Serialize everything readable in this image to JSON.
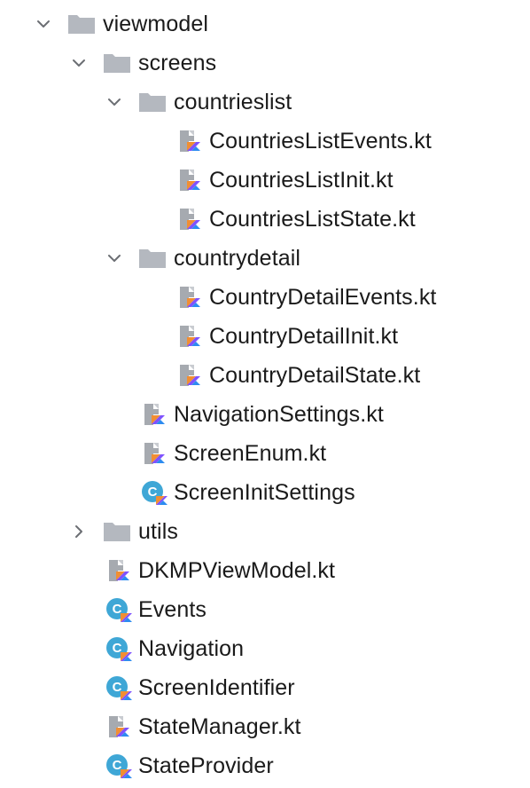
{
  "tree": {
    "rows": [
      {
        "name": "viewmodel",
        "type": "folder",
        "depth": 0,
        "expanded": true
      },
      {
        "name": "screens",
        "type": "folder",
        "depth": 1,
        "expanded": true
      },
      {
        "name": "countrieslist",
        "type": "folder",
        "depth": 2,
        "expanded": true
      },
      {
        "name": "CountriesListEvents.kt",
        "type": "kotlin-file",
        "depth": 3
      },
      {
        "name": "CountriesListInit.kt",
        "type": "kotlin-file",
        "depth": 3
      },
      {
        "name": "CountriesListState.kt",
        "type": "kotlin-file",
        "depth": 3
      },
      {
        "name": "countrydetail",
        "type": "folder",
        "depth": 2,
        "expanded": true
      },
      {
        "name": "CountryDetailEvents.kt",
        "type": "kotlin-file",
        "depth": 3
      },
      {
        "name": "CountryDetailInit.kt",
        "type": "kotlin-file",
        "depth": 3
      },
      {
        "name": "CountryDetailState.kt",
        "type": "kotlin-file",
        "depth": 3
      },
      {
        "name": "NavigationSettings.kt",
        "type": "kotlin-file",
        "depth": 2
      },
      {
        "name": "ScreenEnum.kt",
        "type": "kotlin-file",
        "depth": 2
      },
      {
        "name": "ScreenInitSettings",
        "type": "kotlin-class",
        "depth": 2
      },
      {
        "name": "utils",
        "type": "folder",
        "depth": 1,
        "expanded": false
      },
      {
        "name": "DKMPViewModel.kt",
        "type": "kotlin-file",
        "depth": 1
      },
      {
        "name": "Events",
        "type": "kotlin-class",
        "depth": 1
      },
      {
        "name": "Navigation",
        "type": "kotlin-class",
        "depth": 1
      },
      {
        "name": "ScreenIdentifier",
        "type": "kotlin-class",
        "depth": 1
      },
      {
        "name": "StateManager.kt",
        "type": "kotlin-file",
        "depth": 1
      },
      {
        "name": "StateProvider",
        "type": "kotlin-class",
        "depth": 1
      }
    ]
  },
  "colors": {
    "text": "#1a1a1a",
    "folder": "#b4b8bf",
    "chevron": "#6b6e73",
    "file_page": "#a6aab0",
    "kotlin_orange": "#f18e33",
    "kotlin_purple": "#7f52ff",
    "kotlin_blue": "#2d8cf0",
    "class_circle": "#3fa7d6"
  }
}
